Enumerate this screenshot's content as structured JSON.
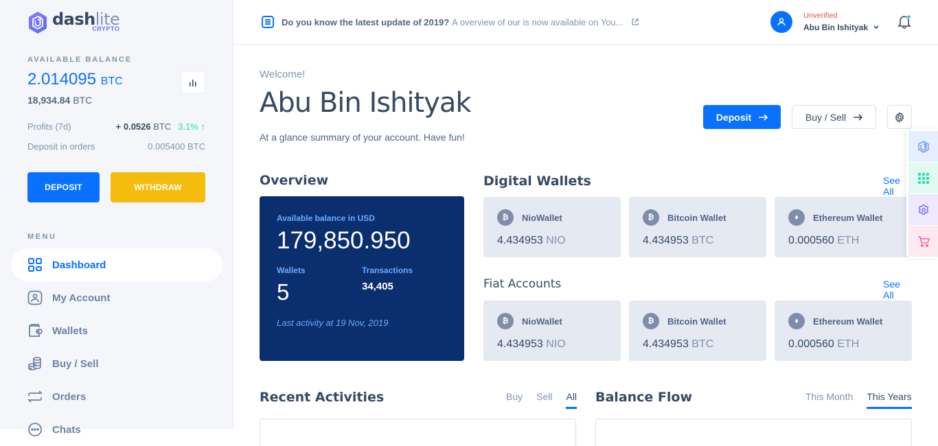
{
  "brand": {
    "name_bold": "dash",
    "name_light": "lite",
    "sub": "CRYPTO"
  },
  "sidebar": {
    "balance_label": "AVAILABLE BALANCE",
    "balance_value": "2.014095",
    "balance_unit": "BTC",
    "balance_alt_value": "18,934.84",
    "balance_alt_unit": "BTC",
    "profits_label": "Profits (7d)",
    "profits_value": "+ 0.0526",
    "profits_unit": "BTC",
    "profits_change": "3.1% ↑",
    "deposit_orders_label": "Deposit in orders",
    "deposit_orders_value": "0.005400 BTC",
    "deposit_button": "DEPOSIT",
    "withdraw_button": "WITHDRAW",
    "menu_label": "MENU",
    "items": [
      {
        "label": "Dashboard",
        "icon": "dashboard-icon",
        "active": true
      },
      {
        "label": "My Account",
        "icon": "user-account-icon"
      },
      {
        "label": "Wallets",
        "icon": "wallet-icon"
      },
      {
        "label": "Buy / Sell",
        "icon": "coins-icon"
      },
      {
        "label": "Orders",
        "icon": "swap-icon"
      },
      {
        "label": "Chats",
        "icon": "chat-icon"
      }
    ]
  },
  "topbar": {
    "news_bold": "Do you know the latest update of 2019?",
    "news_text": "A overview of our is now available on You...",
    "user_status": "Unverified",
    "user_name": "Abu Bin Ishityak"
  },
  "header": {
    "welcome": "Welcome!",
    "name": "Abu Bin Ishityak",
    "subtitle": "At a glance summary of your account. Have fun!",
    "deposit_button": "Deposit",
    "buysell_button": "Buy / Sell"
  },
  "overview": {
    "title": "Overview",
    "balance_label": "Available balance in USD",
    "balance_value": "179,850.950",
    "wallets_label": "Wallets",
    "wallets_value": "5",
    "transactions_label": "Transactions",
    "transactions_value": "34,405",
    "last_activity": "Last activity at 19 Nov, 2019"
  },
  "digital_wallets": {
    "title": "Digital Wallets",
    "see_all": "See All",
    "cards": [
      {
        "name": "NioWallet",
        "amount": "4.434953",
        "unit": "NIO",
        "icon": "bitcoin-icon"
      },
      {
        "name": "Bitcoin Wallet",
        "amount": "4.434953",
        "unit": "BTC",
        "icon": "bitcoin-icon"
      },
      {
        "name": "Ethereum Wallet",
        "amount": "0.000560",
        "unit": "ETH",
        "icon": "ethereum-icon"
      }
    ]
  },
  "fiat_accounts": {
    "title": "Fiat Accounts",
    "see_all": "See All",
    "cards": [
      {
        "name": "NioWallet",
        "amount": "4.434953",
        "unit": "NIO",
        "icon": "bitcoin-icon"
      },
      {
        "name": "Bitcoin Wallet",
        "amount": "4.434953",
        "unit": "BTC",
        "icon": "bitcoin-icon"
      },
      {
        "name": "Ethereum Wallet",
        "amount": "0.000560",
        "unit": "ETH",
        "icon": "ethereum-icon"
      }
    ]
  },
  "recent_activities": {
    "title": "Recent Activities",
    "tabs": [
      "Buy",
      "Sell",
      "All"
    ],
    "active_tab": "All"
  },
  "balance_flow": {
    "title": "Balance Flow",
    "tabs": [
      "This Month",
      "This Years"
    ],
    "active_tab": "This Years"
  },
  "colors": {
    "primary": "#0971fe",
    "warning": "#f4bd0e",
    "navy": "#0b2e6f",
    "success": "#1ee0ac",
    "danger": "#e85347"
  }
}
